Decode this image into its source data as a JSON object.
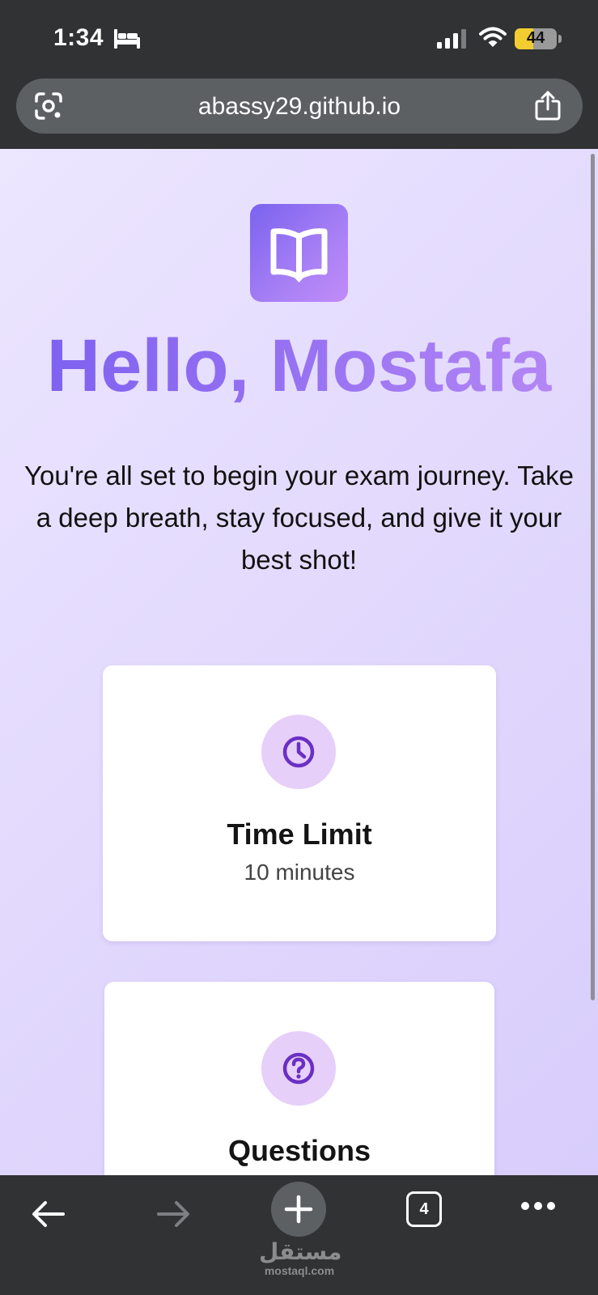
{
  "status_bar": {
    "time": "1:34",
    "battery_level": "44",
    "battery_fraction": 0.44,
    "battery_color": "#f2cd2f"
  },
  "url_bar": {
    "url": "abassy29.github.io"
  },
  "page": {
    "greeting": "Hello, Mostafa",
    "intro": "You're all set to begin your exam journey. Take a deep breath, stay focused, and give it your best shot!",
    "accent_color": "#7a5ff0",
    "cards": [
      {
        "icon": "clock-icon",
        "title": "Time Limit",
        "subtitle": "10 minutes"
      },
      {
        "icon": "question-icon",
        "title": "Questions",
        "subtitle": ""
      }
    ]
  },
  "toolbar": {
    "tab_count": "4"
  },
  "watermark": {
    "arabic": "مستقل",
    "latin": "mostaql.com"
  }
}
